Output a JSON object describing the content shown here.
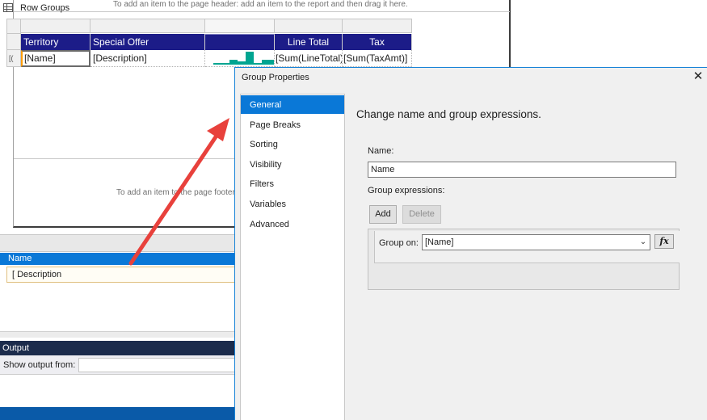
{
  "designer": {
    "header_hint": "To add an item to the page header: add an item to the report and then drag it here.",
    "footer_hint": "To add an item to the page footer",
    "columns": [
      {
        "header": "Territory",
        "data": "[Name]"
      },
      {
        "header": "Special Offer",
        "data": "[Description]"
      },
      {
        "header": "",
        "data": ""
      },
      {
        "header": "Line Total",
        "data": "[Sum(LineTotal)]"
      },
      {
        "header": "Tax",
        "data": "[Sum(TaxAmt)]"
      }
    ],
    "row_handle_glyph": "[(",
    "sparkline_values": [
      1,
      1,
      3,
      2,
      8,
      1,
      3,
      3
    ],
    "sparkline_color": "#00a591",
    "header_color": "#1c1c88"
  },
  "row_groups": {
    "title": "Row Groups",
    "icon": "table-icon",
    "items": [
      {
        "label": "Name",
        "selected": true
      },
      {
        "label": "[ Description",
        "selected": false
      }
    ]
  },
  "output": {
    "title": "Output",
    "show_from_label": "Show output from:",
    "show_from_value": ""
  },
  "dialog": {
    "title": "Group Properties",
    "close_glyph": "✕",
    "nav": [
      "General",
      "Page Breaks",
      "Sorting",
      "Visibility",
      "Filters",
      "Variables",
      "Advanced"
    ],
    "active_nav": "General",
    "heading": "Change name and group expressions.",
    "name_label": "Name:",
    "name_value": "Name",
    "expressions_label": "Group expressions:",
    "add_label": "Add",
    "delete_label": "Delete",
    "group_on_label": "Group on:",
    "group_on_value": "[Name]",
    "fx_label": "fx",
    "accent": "#0a78d7"
  },
  "annotation": {
    "arrow_color": "#e8413c"
  }
}
